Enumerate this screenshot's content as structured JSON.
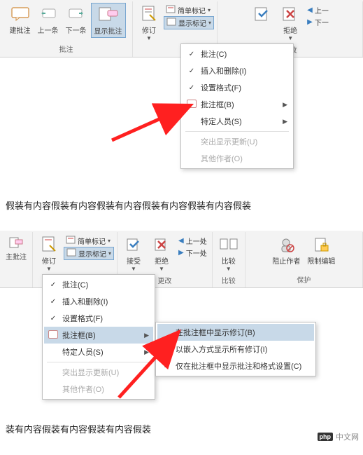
{
  "screenshot1": {
    "ribbon": {
      "comments": {
        "new": "建批注",
        "prev": "上一条",
        "next": "下一条",
        "show": "显示批注",
        "group": "批注"
      },
      "tracking": {
        "revisions": "修订",
        "simple_markup": "简单标记",
        "show_markup": "显示标记"
      },
      "changes": {
        "accept": "接受",
        "reject": "拒绝",
        "prev": "上一",
        "next": "下一",
        "group": "更改"
      }
    },
    "menu": {
      "comments": "批注(C)",
      "insertions": "插入和删除(I)",
      "formatting": "设置格式(F)",
      "balloons": "批注框(B)",
      "people": "特定人员(S)",
      "highlight": "突出显示更新(U)",
      "others": "其他作者(O)"
    },
    "doc_text": "假装有内容假装有内容假装有内容假装有内容假装有内容假装"
  },
  "screenshot2": {
    "ribbon": {
      "comments": {
        "label": "主批注"
      },
      "tracking": {
        "revisions": "修订",
        "simple_markup": "简单标记",
        "show_markup": "显示标记"
      },
      "changes": {
        "accept": "接受",
        "reject": "拒绝",
        "prev": "上一处",
        "next": "下一处",
        "group": "更改"
      },
      "compare": {
        "compare": "比较",
        "group": "比较"
      },
      "protect": {
        "block": "阻止作者",
        "restrict": "限制编辑",
        "group": "保护"
      }
    },
    "menu": {
      "comments": "批注(C)",
      "insertions": "插入和删除(I)",
      "formatting": "设置格式(F)",
      "balloons": "批注框(B)",
      "people": "特定人员(S)",
      "highlight": "突出显示更新(U)",
      "others": "其他作者(O)"
    },
    "submenu": {
      "show_in_balloons": "在批注框中显示修订(B)",
      "inline": "以嵌入方式显示所有修订(I)",
      "only_comments": "仅在批注框中显示批注和格式设置(C)"
    },
    "doc_text": "装有内容假装有内容假装有内容假装"
  },
  "watermark": "中文网"
}
